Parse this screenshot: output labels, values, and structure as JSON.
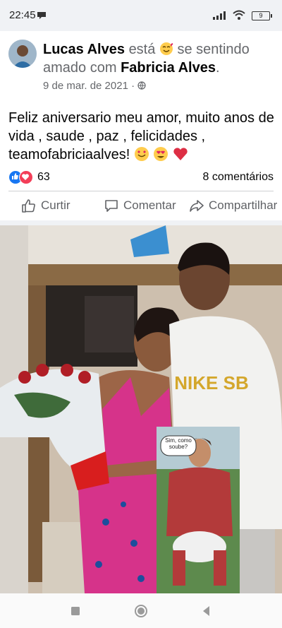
{
  "status_bar": {
    "time": "22:45",
    "battery": "9"
  },
  "post": {
    "author": "Lucas Alves",
    "verb_is": "está",
    "feeling": "se sentindo amado com",
    "tagged": "Fabricia Alves",
    "period": ".",
    "date": "9 de mar. de 2021",
    "privacy_separator": "·",
    "text": "Feliz aniversario meu amor, muito anos de vida , saude , paz , felicidades , teamofabriciaalves!",
    "reaction_count": "63",
    "comments": "8 comentários"
  },
  "actions": {
    "like": "Curtir",
    "comment": "Comentar",
    "share": "Compartilhar"
  },
  "photo": {
    "shirt_text": "NIKE SB",
    "sticker_bubble": "Sim, como soube?"
  },
  "colors": {
    "facebook_blue": "#1877f2",
    "love_red": "#f33e58",
    "secondary_text": "#65676b"
  },
  "icons": [
    "notification-icon",
    "signal-icon",
    "wifi-icon",
    "battery-icon",
    "globe-icon",
    "like-icon",
    "comment-icon",
    "share-icon",
    "nav-recent-icon",
    "nav-home-icon",
    "nav-back-icon"
  ]
}
